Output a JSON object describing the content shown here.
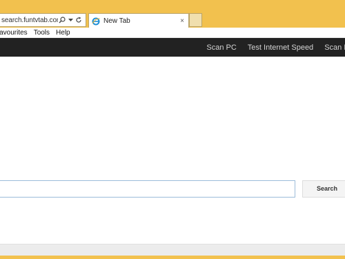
{
  "browser": {
    "address_url": "search.funtvtab.com/",
    "tab_title": "New Tab",
    "tab_close": "×",
    "menu": [
      "Favourites",
      "Tools",
      "Help"
    ]
  },
  "page": {
    "nav_links": [
      "Scan PC",
      "Test Internet Speed",
      "Scan Links"
    ],
    "search_placeholder": "",
    "search_button": "Search"
  },
  "colors": {
    "chrome": "#f2c14e",
    "navbar": "#222222",
    "input_border": "#9bbbd9"
  }
}
